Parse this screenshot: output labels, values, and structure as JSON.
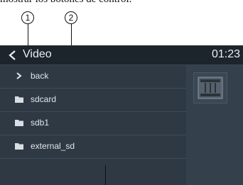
{
  "caption": "mostrar los botones de control.",
  "callouts": {
    "one": "1",
    "two": "2"
  },
  "header": {
    "title": "Video",
    "clock": "01:23"
  },
  "list": {
    "items": [
      {
        "label": "back",
        "icon": "return-arrow-icon"
      },
      {
        "label": "sdcard",
        "icon": "folder-icon"
      },
      {
        "label": "sdb1",
        "icon": "folder-icon"
      },
      {
        "label": "external_sd",
        "icon": "folder-icon"
      }
    ]
  },
  "preview": {
    "icon": "film-strip-icon"
  },
  "colors": {
    "titlebar": "#1d252c",
    "background": "#2f3943",
    "text": "#e8eef3"
  }
}
